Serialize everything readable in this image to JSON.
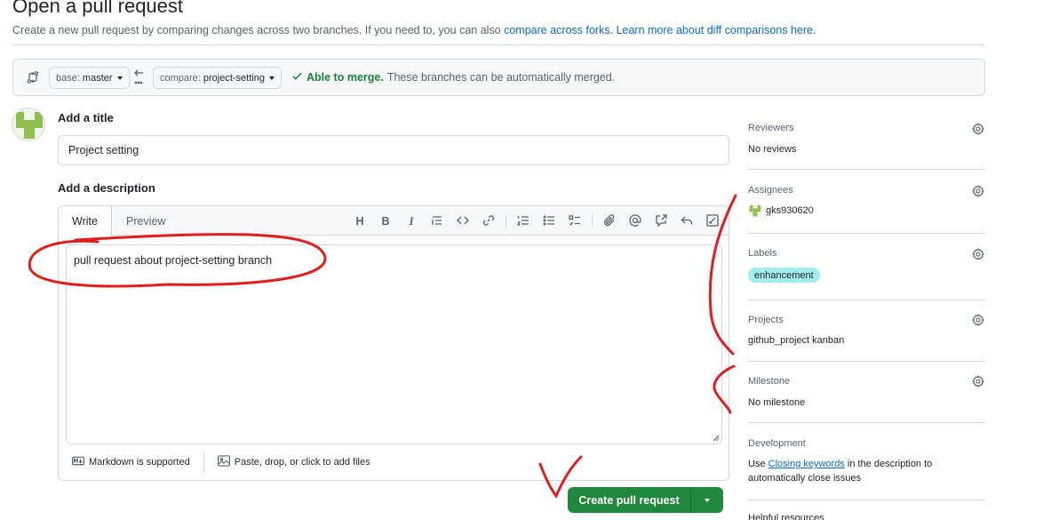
{
  "page": {
    "title": "Open a pull request",
    "subtitle_text": "Create a new pull request by comparing changes across two branches. If you need to, you can also",
    "compare_forks_link": "compare across forks.",
    "learn_more_link": "Learn more about diff comparisons here."
  },
  "compare": {
    "base_prefix": "base:",
    "base_value": "master",
    "compare_prefix": "compare:",
    "compare_value": "project-setting",
    "merge_ok": "Able to merge.",
    "merge_text": "These branches can be automatically merged."
  },
  "form": {
    "title_label": "Add a title",
    "title_value": "Project setting",
    "description_label": "Add a description",
    "tab_write": "Write",
    "tab_preview": "Preview",
    "body_value": "pull request about project-setting branch",
    "markdown_note": "Markdown is supported",
    "attach_note": "Paste, drop, or click to add files",
    "toolbar_heading": "H",
    "toolbar_bold": "B",
    "toolbar_italic": "I"
  },
  "create_button": {
    "label": "Create pull request"
  },
  "sidebar": {
    "reviewers": {
      "title": "Reviewers",
      "value": "No reviews"
    },
    "assignees": {
      "title": "Assignees",
      "value": "gks930620"
    },
    "labels": {
      "title": "Labels",
      "value": "enhancement",
      "color": "#a2eeef"
    },
    "projects": {
      "title": "Projects",
      "value": "github_project kanban"
    },
    "milestone": {
      "title": "Milestone",
      "value": "No milestone"
    },
    "development": {
      "title": "Development",
      "prefix": "Use",
      "link": "Closing keywords",
      "suffix": "in the description to automatically close issues"
    },
    "helpful": {
      "title": "Helpful resources"
    }
  },
  "colors": {
    "accent_green": "#1f883d",
    "link_blue": "#0969da",
    "annotation_red": "#e01e1e"
  }
}
